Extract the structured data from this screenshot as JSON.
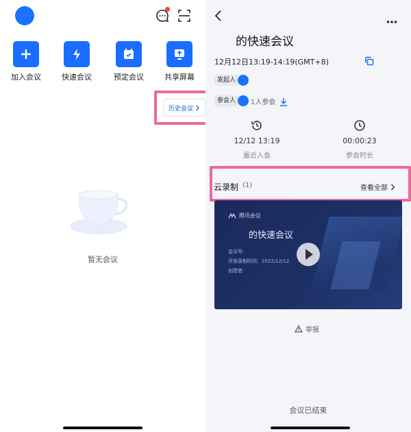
{
  "left": {
    "actions": [
      {
        "label": "加入会议",
        "icon": "plus-icon"
      },
      {
        "label": "快速会议",
        "icon": "lightning-icon"
      },
      {
        "label": "预定会议",
        "icon": "calendar-check-icon"
      },
      {
        "label": "共享屏幕",
        "icon": "share-screen-icon"
      }
    ],
    "history_button": "历史会议",
    "empty_text": "暂无会议",
    "accent": "#1a6dff",
    "highlight": "#ea6aa0"
  },
  "right": {
    "meeting_title": "的快速会议",
    "time_range": "12月12日13:19-14:19(GMT+8)",
    "initiator_label": "发起人",
    "participants_label": "参会人",
    "participant_count": "1人参会",
    "stats": [
      {
        "value": "12/12 13:19",
        "caption": "最近入会",
        "icon": "history-clock-icon"
      },
      {
        "value": "00:00:23",
        "caption": "参会时长",
        "icon": "clock-icon"
      }
    ],
    "recording": {
      "title": "云录制",
      "count": "(1)",
      "view_all": "查看全部",
      "thumbnail": {
        "brand": "腾讯会议",
        "title": "的快速会议",
        "lines": [
          "会议号:",
          "开始录制时间：2022/12/12",
          "创建者:"
        ]
      }
    },
    "report_label": "举报",
    "ended_label": "会议已结束"
  }
}
